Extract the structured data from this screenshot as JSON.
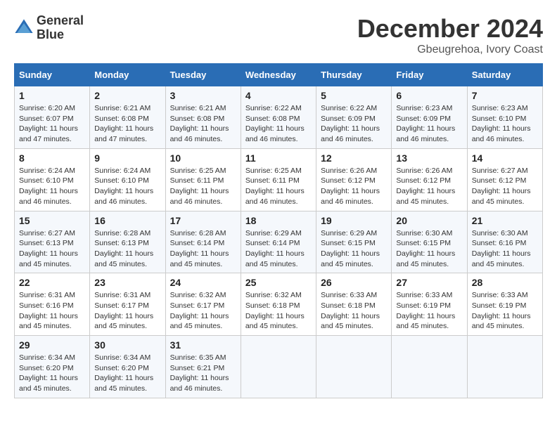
{
  "header": {
    "logo_line1": "General",
    "logo_line2": "Blue",
    "title": "December 2024",
    "subtitle": "Gbeugrehoa, Ivory Coast"
  },
  "weekdays": [
    "Sunday",
    "Monday",
    "Tuesday",
    "Wednesday",
    "Thursday",
    "Friday",
    "Saturday"
  ],
  "weeks": [
    [
      {
        "day": "1",
        "info": "Sunrise: 6:20 AM\nSunset: 6:07 PM\nDaylight: 11 hours\nand 47 minutes."
      },
      {
        "day": "2",
        "info": "Sunrise: 6:21 AM\nSunset: 6:08 PM\nDaylight: 11 hours\nand 47 minutes."
      },
      {
        "day": "3",
        "info": "Sunrise: 6:21 AM\nSunset: 6:08 PM\nDaylight: 11 hours\nand 46 minutes."
      },
      {
        "day": "4",
        "info": "Sunrise: 6:22 AM\nSunset: 6:08 PM\nDaylight: 11 hours\nand 46 minutes."
      },
      {
        "day": "5",
        "info": "Sunrise: 6:22 AM\nSunset: 6:09 PM\nDaylight: 11 hours\nand 46 minutes."
      },
      {
        "day": "6",
        "info": "Sunrise: 6:23 AM\nSunset: 6:09 PM\nDaylight: 11 hours\nand 46 minutes."
      },
      {
        "day": "7",
        "info": "Sunrise: 6:23 AM\nSunset: 6:10 PM\nDaylight: 11 hours\nand 46 minutes."
      }
    ],
    [
      {
        "day": "8",
        "info": "Sunrise: 6:24 AM\nSunset: 6:10 PM\nDaylight: 11 hours\nand 46 minutes."
      },
      {
        "day": "9",
        "info": "Sunrise: 6:24 AM\nSunset: 6:10 PM\nDaylight: 11 hours\nand 46 minutes."
      },
      {
        "day": "10",
        "info": "Sunrise: 6:25 AM\nSunset: 6:11 PM\nDaylight: 11 hours\nand 46 minutes."
      },
      {
        "day": "11",
        "info": "Sunrise: 6:25 AM\nSunset: 6:11 PM\nDaylight: 11 hours\nand 46 minutes."
      },
      {
        "day": "12",
        "info": "Sunrise: 6:26 AM\nSunset: 6:12 PM\nDaylight: 11 hours\nand 46 minutes."
      },
      {
        "day": "13",
        "info": "Sunrise: 6:26 AM\nSunset: 6:12 PM\nDaylight: 11 hours\nand 45 minutes."
      },
      {
        "day": "14",
        "info": "Sunrise: 6:27 AM\nSunset: 6:12 PM\nDaylight: 11 hours\nand 45 minutes."
      }
    ],
    [
      {
        "day": "15",
        "info": "Sunrise: 6:27 AM\nSunset: 6:13 PM\nDaylight: 11 hours\nand 45 minutes."
      },
      {
        "day": "16",
        "info": "Sunrise: 6:28 AM\nSunset: 6:13 PM\nDaylight: 11 hours\nand 45 minutes."
      },
      {
        "day": "17",
        "info": "Sunrise: 6:28 AM\nSunset: 6:14 PM\nDaylight: 11 hours\nand 45 minutes."
      },
      {
        "day": "18",
        "info": "Sunrise: 6:29 AM\nSunset: 6:14 PM\nDaylight: 11 hours\nand 45 minutes."
      },
      {
        "day": "19",
        "info": "Sunrise: 6:29 AM\nSunset: 6:15 PM\nDaylight: 11 hours\nand 45 minutes."
      },
      {
        "day": "20",
        "info": "Sunrise: 6:30 AM\nSunset: 6:15 PM\nDaylight: 11 hours\nand 45 minutes."
      },
      {
        "day": "21",
        "info": "Sunrise: 6:30 AM\nSunset: 6:16 PM\nDaylight: 11 hours\nand 45 minutes."
      }
    ],
    [
      {
        "day": "22",
        "info": "Sunrise: 6:31 AM\nSunset: 6:16 PM\nDaylight: 11 hours\nand 45 minutes."
      },
      {
        "day": "23",
        "info": "Sunrise: 6:31 AM\nSunset: 6:17 PM\nDaylight: 11 hours\nand 45 minutes."
      },
      {
        "day": "24",
        "info": "Sunrise: 6:32 AM\nSunset: 6:17 PM\nDaylight: 11 hours\nand 45 minutes."
      },
      {
        "day": "25",
        "info": "Sunrise: 6:32 AM\nSunset: 6:18 PM\nDaylight: 11 hours\nand 45 minutes."
      },
      {
        "day": "26",
        "info": "Sunrise: 6:33 AM\nSunset: 6:18 PM\nDaylight: 11 hours\nand 45 minutes."
      },
      {
        "day": "27",
        "info": "Sunrise: 6:33 AM\nSunset: 6:19 PM\nDaylight: 11 hours\nand 45 minutes."
      },
      {
        "day": "28",
        "info": "Sunrise: 6:33 AM\nSunset: 6:19 PM\nDaylight: 11 hours\nand 45 minutes."
      }
    ],
    [
      {
        "day": "29",
        "info": "Sunrise: 6:34 AM\nSunset: 6:20 PM\nDaylight: 11 hours\nand 45 minutes."
      },
      {
        "day": "30",
        "info": "Sunrise: 6:34 AM\nSunset: 6:20 PM\nDaylight: 11 hours\nand 45 minutes."
      },
      {
        "day": "31",
        "info": "Sunrise: 6:35 AM\nSunset: 6:21 PM\nDaylight: 11 hours\nand 46 minutes."
      },
      {
        "day": "",
        "info": ""
      },
      {
        "day": "",
        "info": ""
      },
      {
        "day": "",
        "info": ""
      },
      {
        "day": "",
        "info": ""
      }
    ]
  ]
}
